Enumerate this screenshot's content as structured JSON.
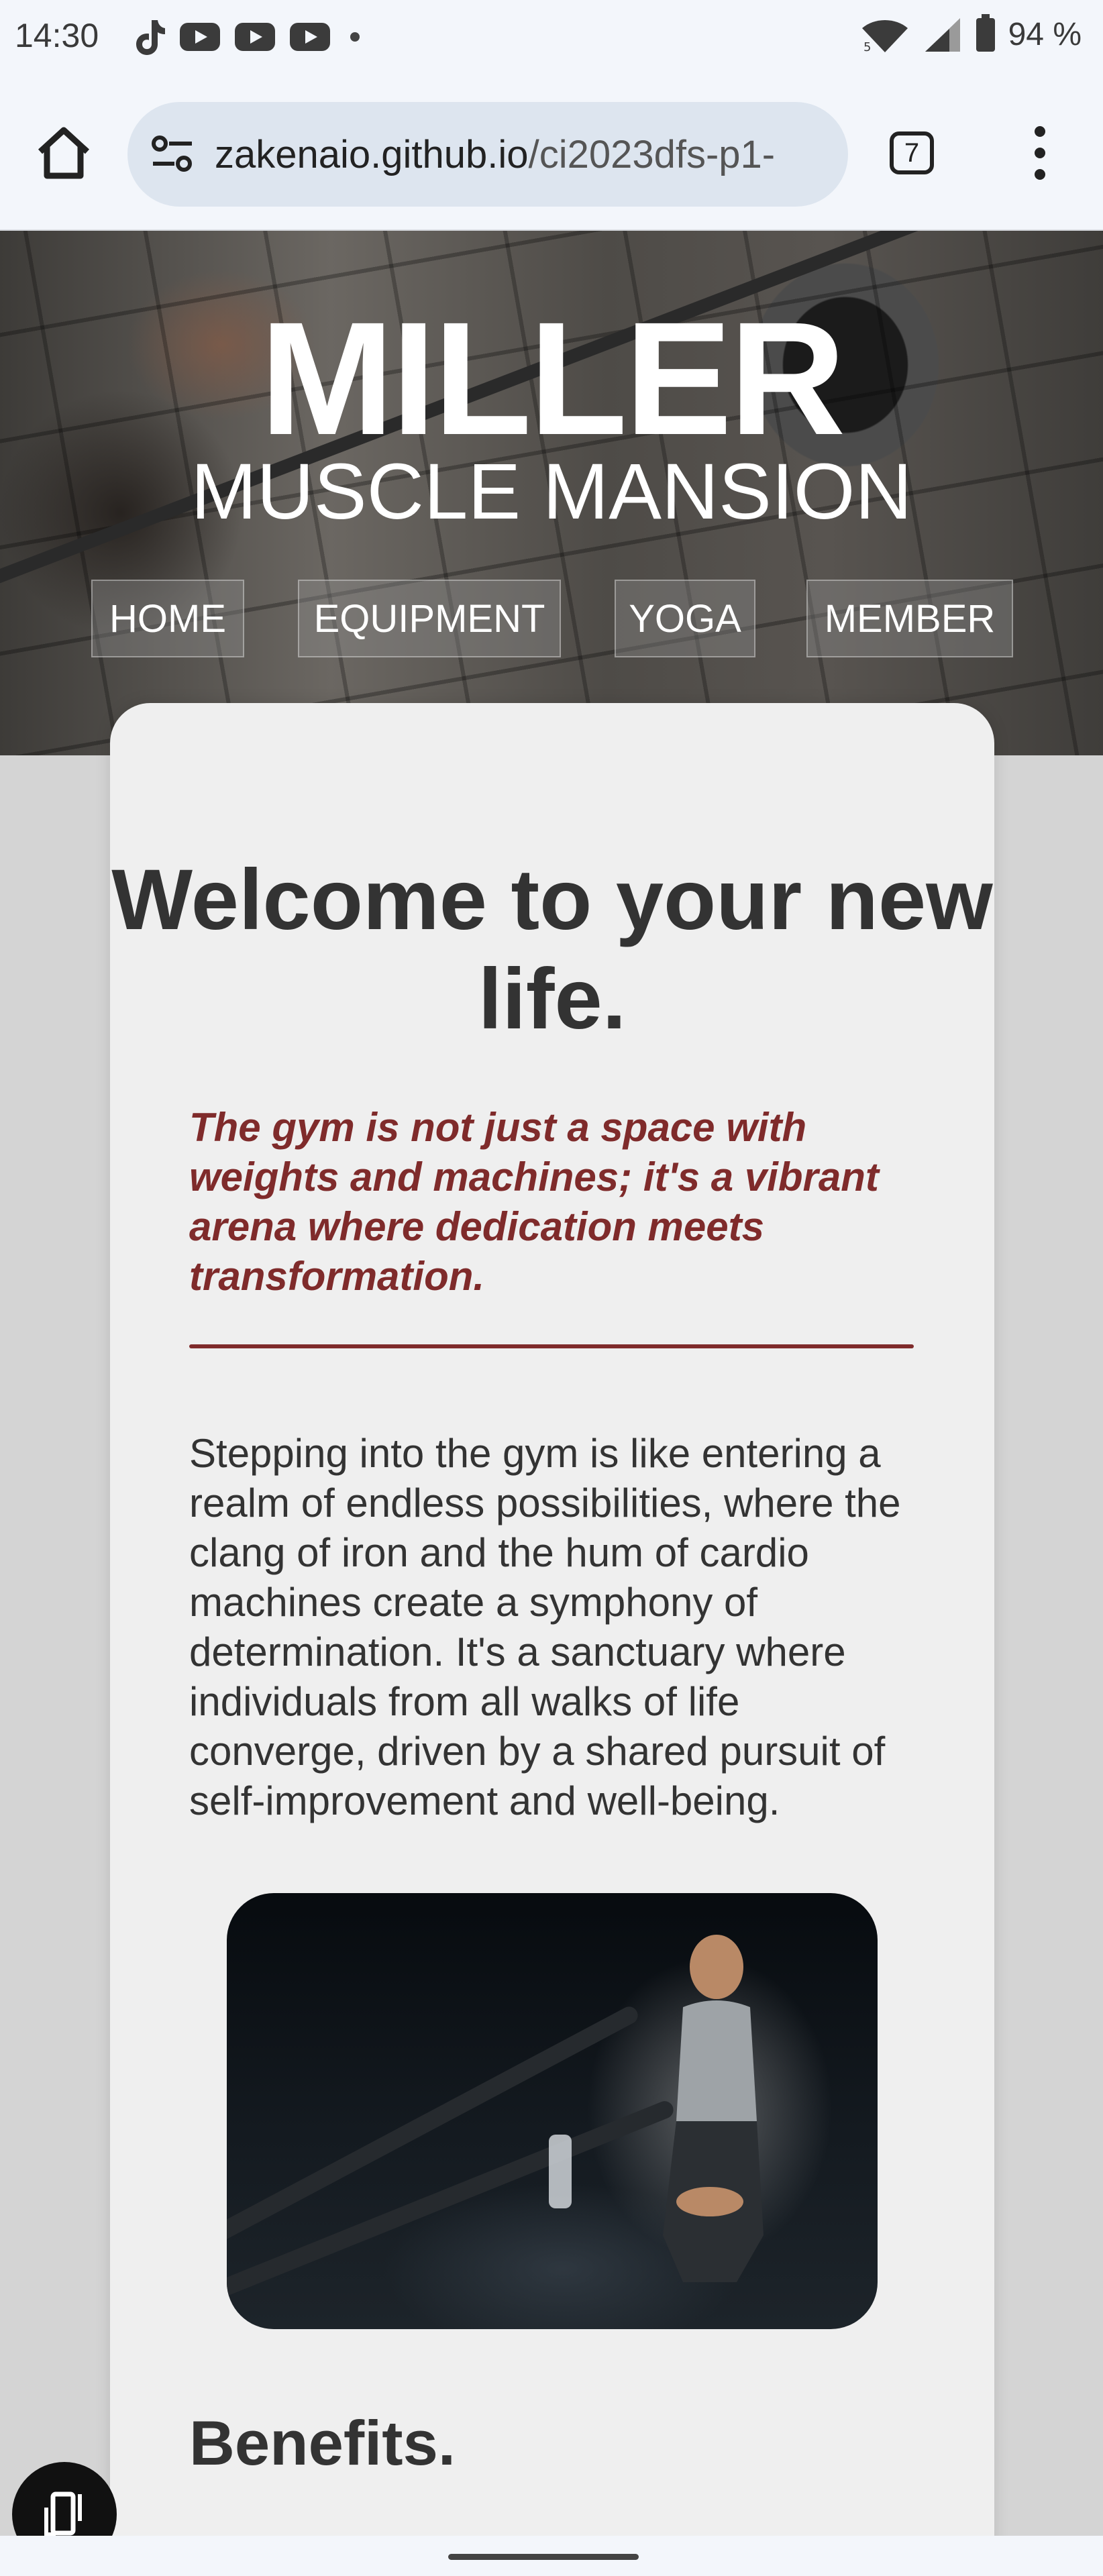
{
  "status_bar": {
    "time": "14:30",
    "app_icons": [
      "tiktok-icon",
      "youtube-icon",
      "youtube-icon",
      "youtube-icon"
    ],
    "wifi_badge": "5",
    "battery": "94 %"
  },
  "browser": {
    "url_host": "zakenaio.github.io",
    "url_path": "/ci2023dfs-p1-",
    "tab_count": "7"
  },
  "hero": {
    "title": "MILLER",
    "subtitle": "MUSCLE MANSION",
    "nav": [
      "HOME",
      "EQUIPMENT",
      "YOGA",
      "MEMBER"
    ]
  },
  "content": {
    "heading": "Welcome to your new life.",
    "quote": "The gym is not just a space with weights and machines; it's a vibrant arena where dedication meets transformation.",
    "body": "Stepping into the gym is like entering a realm of endless possibilities, where the clang of iron and the hum of cardio machines create a symphony of determination. It's a sanctuary where individuals from all walks of life converge, driven by a shared pursuit of self-improvement and well-being.",
    "benefits_heading": "Benefits."
  },
  "colors": {
    "accent": "#7f2b2b",
    "text": "#333333",
    "card": "#efefef",
    "page_bg": "#d4d4d4"
  }
}
